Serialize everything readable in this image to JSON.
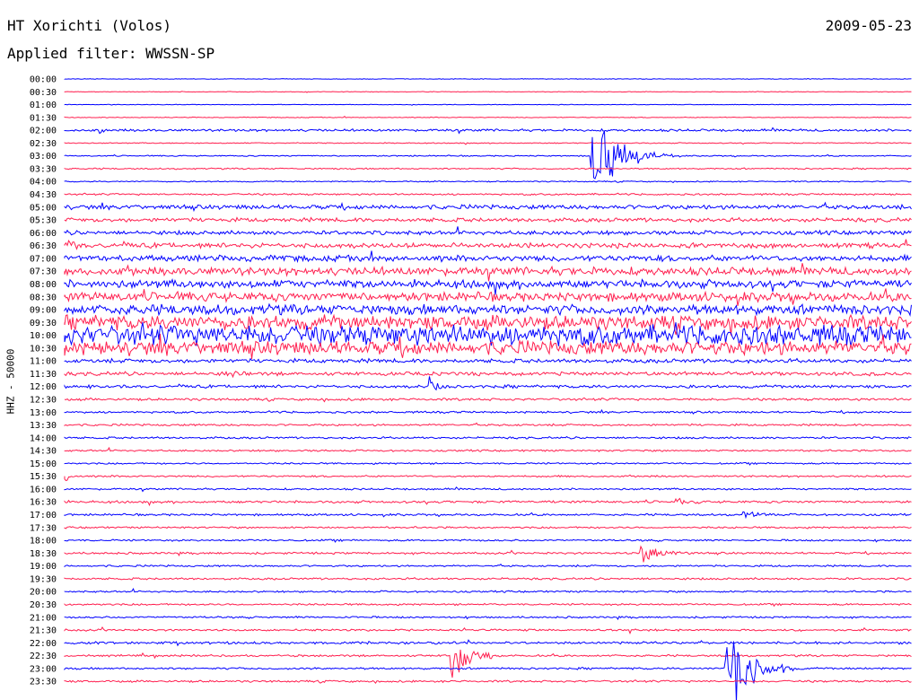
{
  "header": {
    "station": "HT Xorichti (Volos)",
    "date": "2009-05-23",
    "filter": "Applied filter: WWSSN-SP"
  },
  "chart_data": {
    "type": "seismogram",
    "ylabel": "HHZ - 50000",
    "colors": [
      "#0000ff",
      "#ff1f4f"
    ],
    "rows": [
      "00:00",
      "00:30",
      "01:00",
      "01:30",
      "02:00",
      "02:30",
      "03:00",
      "03:30",
      "04:00",
      "04:30",
      "05:00",
      "05:30",
      "06:00",
      "06:30",
      "07:00",
      "07:30",
      "08:00",
      "08:30",
      "09:00",
      "09:30",
      "10:00",
      "10:30",
      "11:00",
      "11:30",
      "12:00",
      "12:30",
      "13:00",
      "13:30",
      "14:00",
      "14:30",
      "15:00",
      "15:30",
      "16:00",
      "16:30",
      "17:00",
      "17:30",
      "18:00",
      "18:30",
      "19:00",
      "19:30",
      "20:00",
      "20:30",
      "21:00",
      "21:30",
      "22:00",
      "22:30",
      "23:00",
      "23:30"
    ],
    "noise_level": [
      0.3,
      0.3,
      0.3,
      0.4,
      1.2,
      0.5,
      0.6,
      0.7,
      0.6,
      0.9,
      2.2,
      2.0,
      2.0,
      2.5,
      3.0,
      4.0,
      4.0,
      4.5,
      5.0,
      7.0,
      10.0,
      7.0,
      2.0,
      1.8,
      1.5,
      1.2,
      1.0,
      1.0,
      1.0,
      0.9,
      0.8,
      0.9,
      0.9,
      1.2,
      1.0,
      0.9,
      0.9,
      1.0,
      0.9,
      1.0,
      0.9,
      0.9,
      0.9,
      1.0,
      1.2,
      1.0,
      1.0,
      1.0
    ],
    "events": [
      {
        "row": 6,
        "x": 0.62,
        "amp": 55,
        "len": 0.1,
        "color_index": 1
      },
      {
        "row": 45,
        "x": 0.455,
        "amp": 65,
        "len": 0.05,
        "color_index": 0
      },
      {
        "row": 46,
        "x": 0.78,
        "amp": 65,
        "len": 0.08,
        "color_index": 0
      },
      {
        "row": 37,
        "x": 0.68,
        "amp": 12,
        "len": 0.06,
        "color_index": 1
      },
      {
        "row": 24,
        "x": 0.43,
        "amp": 18,
        "len": 0.02,
        "color_index": 0
      },
      {
        "row": 13,
        "x": 0.0,
        "amp": 15,
        "len": 0.02,
        "color_index": 1
      },
      {
        "row": 31,
        "x": 0.0,
        "amp": 10,
        "len": 0.01,
        "color_index": 0
      },
      {
        "row": 34,
        "x": 0.8,
        "amp": 6,
        "len": 0.04,
        "color_index": 0
      },
      {
        "row": 33,
        "x": 0.72,
        "amp": 6,
        "len": 0.03,
        "color_index": 1
      },
      {
        "row": 4,
        "x": 0.04,
        "amp": 6,
        "len": 0.01,
        "color_index": 0
      },
      {
        "row": 23,
        "x": 0.19,
        "amp": 6,
        "len": 0.03,
        "color_index": 1
      }
    ]
  }
}
